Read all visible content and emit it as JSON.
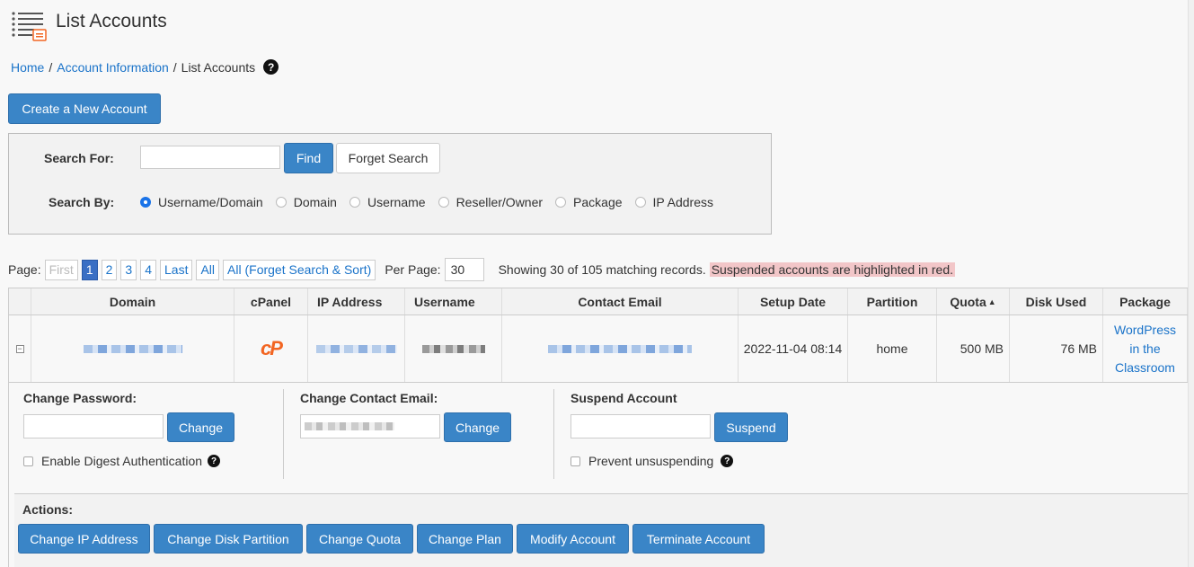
{
  "header": {
    "title": "List Accounts",
    "icon": "list-icon"
  },
  "breadcrumb": {
    "items": [
      "Home",
      "Account Information",
      "List Accounts"
    ],
    "separator": "/",
    "help": "?"
  },
  "create_button": "Create a New Account",
  "search": {
    "label": "Search For:",
    "value": "",
    "find_label": "Find",
    "forget_label": "Forget Search",
    "by_label": "Search By:",
    "options": [
      "Username/Domain",
      "Domain",
      "Username",
      "Reseller/Owner",
      "Package",
      "IP Address"
    ],
    "selected": "Username/Domain"
  },
  "pager": {
    "label": "Page:",
    "first": "First",
    "pages": [
      "1",
      "2",
      "3",
      "4"
    ],
    "current": "1",
    "last": "Last",
    "all": "All",
    "all_forget": "All (Forget Search & Sort)",
    "per_page_label": "Per Page:",
    "per_page": "30",
    "showing": "Showing 30 of 105 matching records.",
    "suspended_note": "Suspended accounts are highlighted in red."
  },
  "table": {
    "columns": [
      "Domain",
      "cPanel",
      "IP Address",
      "Username",
      "Contact Email",
      "Setup Date",
      "Partition",
      "Quota",
      "Disk Used",
      "Package"
    ],
    "sort_indicator": "▲",
    "row": {
      "setup_date": "2022-11-04 08:14",
      "partition": "home",
      "quota": "500 MB",
      "disk_used": "76 MB",
      "package": "WordPress in the Classroom",
      "cpanel_logo": "cP"
    }
  },
  "expanded": {
    "change_password": {
      "label": "Change Password:",
      "button": "Change",
      "digest": "Enable Digest Authentication"
    },
    "change_email": {
      "label": "Change Contact Email:",
      "button": "Change"
    },
    "suspend": {
      "label": "Suspend Account",
      "button": "Suspend",
      "prevent": "Prevent unsuspending"
    },
    "actions_label": "Actions:",
    "actions": [
      "Change IP Address",
      "Change Disk Partition",
      "Change Quota",
      "Change Plan",
      "Modify Account",
      "Terminate Account"
    ]
  },
  "colors": {
    "primary": "#3a85c7",
    "link": "#1a73c9",
    "suspended": "#f2c6c8",
    "cpanel": "#f26522"
  }
}
